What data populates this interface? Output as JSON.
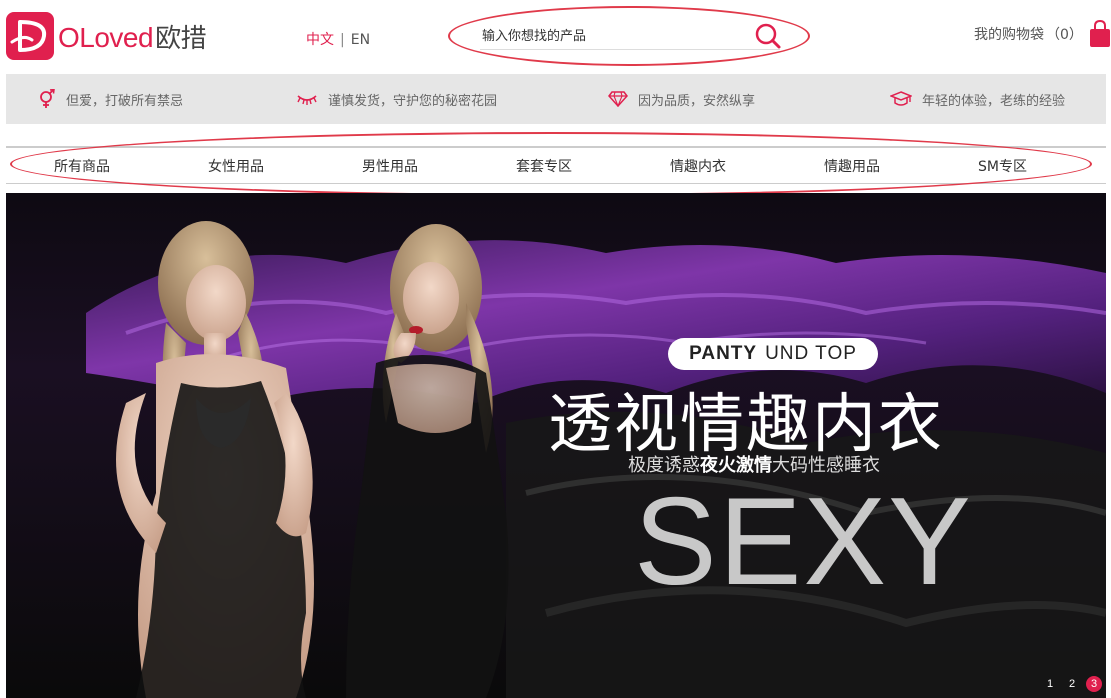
{
  "brand": {
    "name_en": "OLoved",
    "name_cn": "欧措"
  },
  "lang": {
    "cn": "中文",
    "sep": "|",
    "en": "EN"
  },
  "search": {
    "placeholder": "输入你想找的产品"
  },
  "cart": {
    "label": "我的购物袋",
    "count": "（0）"
  },
  "promo": [
    {
      "icon": "gender-icon",
      "text": "但爱，打破所有禁忌"
    },
    {
      "icon": "eyelash-icon",
      "text": "谨慎发货，守护您的秘密花园"
    },
    {
      "icon": "diamond-icon",
      "text": "因为品质，安然纵享"
    },
    {
      "icon": "graduation-cap-icon",
      "text": "年轻的体验，老练的经验"
    }
  ],
  "nav": [
    "所有商品",
    "女性用品",
    "男性用品",
    "套套专区",
    "情趣内衣",
    "情趣用品",
    "SM专区"
  ],
  "banner": {
    "tag_bold": "PANTY",
    "tag_rest": "UND TOP",
    "headline": "透视情趣内衣",
    "sub_pre": "极度诱惑",
    "sub_bold": "夜火激情",
    "sub_post": "大码性感睡衣",
    "big": "SEXY"
  },
  "pager": [
    "1",
    "2",
    "3"
  ],
  "colors": {
    "accent": "#e0204e",
    "annotation": "#e03a4a",
    "promo_bg": "#e6e6e6"
  }
}
